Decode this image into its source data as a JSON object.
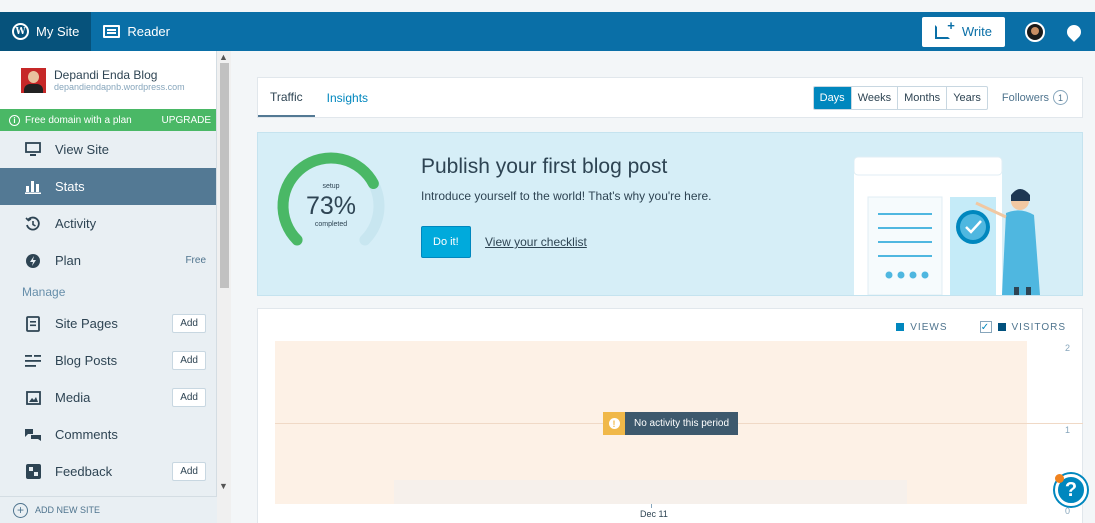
{
  "topbar": {
    "my_site": "My Site",
    "reader": "Reader",
    "write": "Write"
  },
  "sidebar": {
    "site_name": "Depandi Enda Blog",
    "site_url": "depandiendapnb.wordpress.com",
    "domain_banner": "Free domain with a plan",
    "upgrade": "UPGRADE",
    "items_top": [
      {
        "label": "View Site",
        "icon": "monitor-icon"
      },
      {
        "label": "Stats",
        "icon": "stats-icon",
        "active": true
      },
      {
        "label": "Activity",
        "icon": "activity-icon"
      },
      {
        "label": "Plan",
        "icon": "plan-icon",
        "extra": "Free"
      }
    ],
    "manage_label": "Manage",
    "items_manage": [
      {
        "label": "Site Pages",
        "icon": "pages-icon",
        "action": "Add"
      },
      {
        "label": "Blog Posts",
        "icon": "posts-icon",
        "action": "Add"
      },
      {
        "label": "Media",
        "icon": "media-icon",
        "action": "Add"
      },
      {
        "label": "Comments",
        "icon": "comments-icon"
      },
      {
        "label": "Feedback",
        "icon": "feedback-icon",
        "action": "Add"
      }
    ],
    "add_new_site": "ADD NEW SITE"
  },
  "stats": {
    "tabs": {
      "traffic": "Traffic",
      "insights": "Insights"
    },
    "periods": {
      "days": "Days",
      "weeks": "Weeks",
      "months": "Months",
      "years": "Years"
    },
    "selected_period": "Days",
    "followers_label": "Followers",
    "followers_count": "1"
  },
  "checklist": {
    "setup_label": "setup",
    "percent": "73%",
    "percent_value": 0.73,
    "completed_label": "completed",
    "title": "Publish your first blog post",
    "subtitle": "Introduce yourself to the world! That's why you're here.",
    "do_it": "Do it!",
    "view_checklist": "View your checklist",
    "accent": "#4ab866"
  },
  "chart_data": {
    "type": "bar",
    "categories": [
      "Dec 11"
    ],
    "series": [
      {
        "name": "VIEWS",
        "values": [
          0
        ]
      },
      {
        "name": "VISITORS",
        "values": [
          0
        ]
      }
    ],
    "ylim": [
      0,
      2
    ],
    "yticks": [
      "2",
      "1",
      "0"
    ],
    "empty_message": "No activity this period",
    "legend": "top-right",
    "colors": {
      "views": "#0087be",
      "visitors": "#01517d"
    }
  }
}
